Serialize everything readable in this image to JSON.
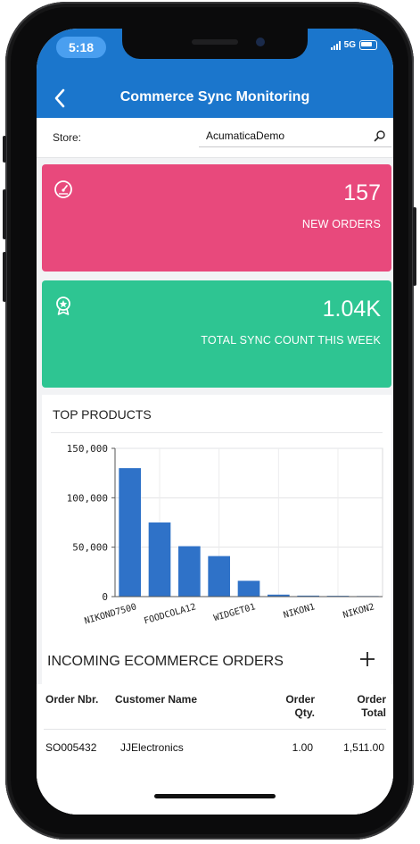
{
  "status_bar": {
    "time": "5:18",
    "network": "5G"
  },
  "nav": {
    "title": "Commerce Sync Monitoring"
  },
  "store": {
    "label": "Store:",
    "value": "AcumaticaDemo"
  },
  "tiles": [
    {
      "value": "157",
      "caption": "NEW ORDERS",
      "color": "#e8497c",
      "icon": "speedometer-icon"
    },
    {
      "value": "1.04K",
      "caption": "TOTAL SYNC COUNT THIS WEEK",
      "color": "#2ec592",
      "icon": "award-badge-icon"
    }
  ],
  "top_products": {
    "title": "TOP PRODUCTS"
  },
  "chart_data": {
    "type": "bar",
    "title": "TOP PRODUCTS",
    "categories": [
      "NIKOND7500",
      "",
      "FOODCOLA12",
      "",
      "WIDGET01",
      "",
      "NIKON1",
      "",
      "NIKON2"
    ],
    "values": [
      130000,
      75000,
      51000,
      41000,
      16000,
      2000,
      1000,
      800,
      600
    ],
    "yticks": [
      "150,000",
      "100,000",
      "50,000",
      "0"
    ],
    "ylim": [
      0,
      150000
    ],
    "grid": true,
    "bar_color": "#2f72c8"
  },
  "orders": {
    "title": "INCOMING ECOMMERCE ORDERS",
    "columns": [
      "Order Nbr.",
      "Customer Name",
      "Order Qty.",
      "Order Total"
    ],
    "rows": [
      {
        "order_nbr": "SO005432",
        "customer": "JJElectronics",
        "qty": "1.00",
        "total": "1,511.00"
      }
    ]
  }
}
